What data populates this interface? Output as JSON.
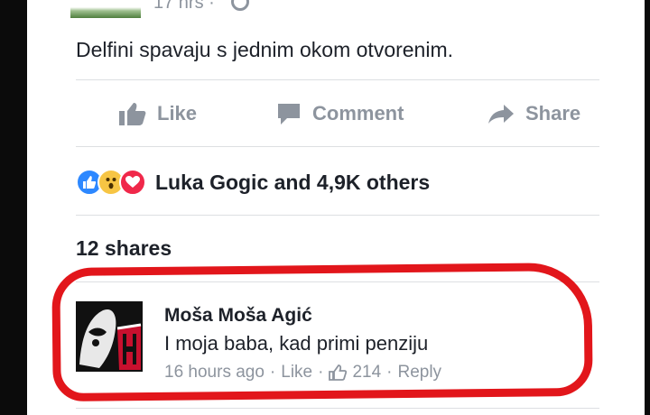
{
  "post": {
    "timestamp": "17 hrs ·",
    "text": "Delfini spavaju s jednim okom otvorenim."
  },
  "actions": {
    "like_label": "Like",
    "comment_label": "Comment",
    "share_label": "Share"
  },
  "reactions": {
    "label": "Luka Gogic and 4,9K others",
    "icons": [
      "like-reaction-icon",
      "wow-reaction-icon",
      "love-reaction-icon"
    ]
  },
  "shares": {
    "label": "12 shares"
  },
  "comment": {
    "author": "Moša Moša Agić",
    "text": "I moja baba, kad primi penziju",
    "time": "16 hours ago",
    "like_label": "Like",
    "like_count": "214",
    "reply_label": "Reply",
    "separator": "·"
  },
  "colors": {
    "text": "#1d2129",
    "muted": "#8d949e",
    "divider": "#dddfe2",
    "highlight": "#e2161b",
    "like_blue": "#2d88ff"
  }
}
